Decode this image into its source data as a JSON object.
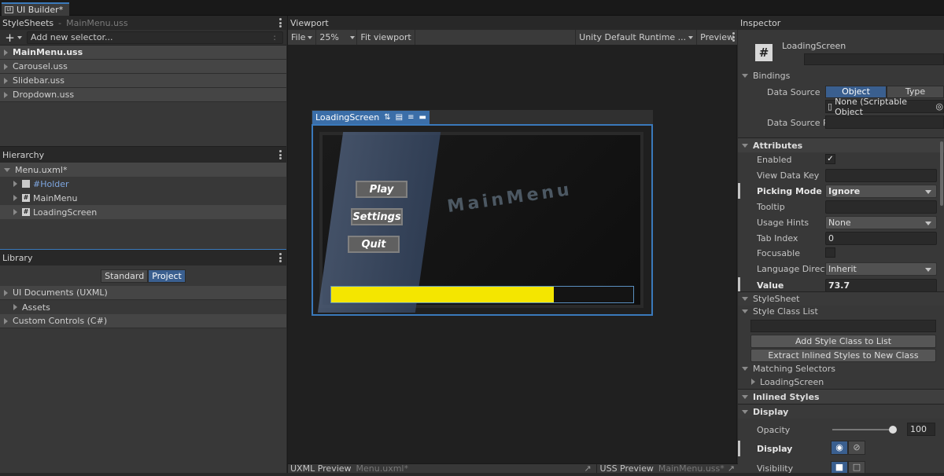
{
  "window": {
    "tab_title": "UI Builder*",
    "tab_icon": "ui-builder-icon"
  },
  "stylesheets": {
    "title": "StyleSheets",
    "subtitle": "MainMenu.uss",
    "add_selector_placeholder": "Add new selector...",
    "add_selector_shortcut": ":",
    "items": [
      {
        "label": "MainMenu.uss",
        "active": true
      },
      {
        "label": "Carousel.uss",
        "active": false
      },
      {
        "label": "Slidebar.uss",
        "active": false
      },
      {
        "label": "Dropdown.uss",
        "active": false
      }
    ]
  },
  "hierarchy": {
    "title": "Hierarchy",
    "root": "Menu.uxml*",
    "items": [
      "#Holder",
      "MainMenu",
      "LoadingScreen"
    ]
  },
  "library": {
    "title": "Library",
    "tabs": [
      "Standard",
      "Project"
    ],
    "items": [
      {
        "label": "UI Documents (UXML)",
        "level": 0
      },
      {
        "label": "Assets",
        "level": 1
      },
      {
        "label": "Custom Controls (C#)",
        "level": 0
      }
    ]
  },
  "viewport": {
    "title": "Viewport",
    "file_menu": "File",
    "zoom": "25%",
    "fit": "Fit viewport",
    "theme": "Unity Default Runtime ...",
    "preview": "Preview",
    "selected_label": "LoadingScreen",
    "canvas": {
      "buttons": [
        "Play",
        "Settings",
        "Quit"
      ],
      "watermark": "MainMenu",
      "progress": 0.737,
      "progress_color": "#f4e600"
    },
    "bottom_left": {
      "title": "UXML Preview",
      "file": "Menu.uxml*"
    },
    "bottom_right": {
      "title": "USS Preview",
      "file": "MainMenu.uss*"
    }
  },
  "inspector": {
    "title": "Inspector",
    "element_name": "LoadingScreen",
    "bindings": {
      "title": "Bindings",
      "data_source_label": "Data Source",
      "tabs": [
        "Object",
        "Type"
      ],
      "object_field": "None (Scriptable Object",
      "data_source_path_label": "Data Source P"
    },
    "attributes": {
      "title": "Attributes",
      "enabled": "Enabled",
      "enabled_check": "✓",
      "view_data_key": "View Data Key",
      "picking_mode": "Picking Mode",
      "picking_mode_value": "Ignore",
      "tooltip": "Tooltip",
      "usage_hints": "Usage Hints",
      "usage_hints_value": "None",
      "tab_index": "Tab Index",
      "tab_index_value": "0",
      "focusable": "Focusable",
      "language_direction": "Language Directi",
      "language_direction_value": "Inherit",
      "value": "Value",
      "value_value": "73.7"
    },
    "stylesheet": {
      "title": "StyleSheet",
      "style_class_list": "Style Class List",
      "add_class": "Add Style Class to List",
      "extract": "Extract Inlined Styles to New Class",
      "matching_selectors": "Matching Selectors",
      "matching_item": "LoadingScreen"
    },
    "inlined": {
      "title": "Inlined Styles",
      "display_title": "Display",
      "opacity": "Opacity",
      "opacity_value": "100",
      "display": "Display",
      "visibility": "Visibility"
    },
    "accent_color": "#3a5f8f"
  }
}
